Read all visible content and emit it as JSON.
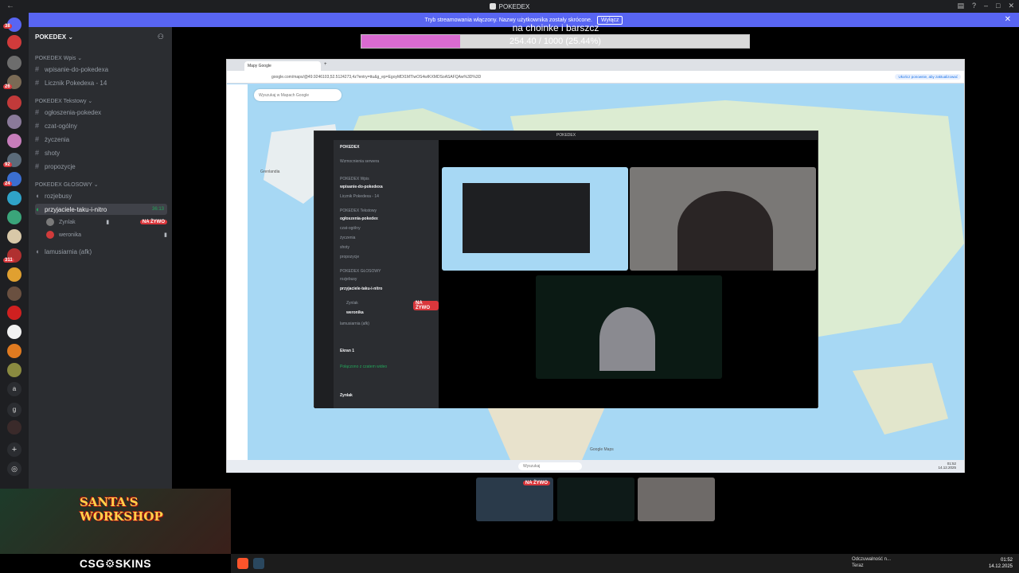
{
  "window": {
    "title": "POKEDEX"
  },
  "banner": {
    "text": "Tryb streamowania włączony. Nazwy użytkownika zostały skrócone.",
    "button": "Wyłącz"
  },
  "rail": {
    "badges": [
      "38",
      "26",
      "92",
      "24",
      "311"
    ]
  },
  "sidebar": {
    "server_name": "POKEDEX",
    "categories": [
      {
        "label": "POKEDEX Wpis",
        "channels": [
          "wpisanie-do-pokedexa",
          "Licznik Pokedexa - 14"
        ]
      },
      {
        "label": "POKEDEX Tekstowy",
        "channels": [
          "ogłoszenia-pokedex",
          "czat-ogólny",
          "życzenia",
          "shoty",
          "propozycje"
        ]
      },
      {
        "label": "POKEDEX GŁOSOWY",
        "channels": [
          "rozjebusy",
          "przyjaciele-taku-i-nitro",
          "lamusiarnia (afk)"
        ]
      }
    ],
    "active_timer": "36:13",
    "members": [
      {
        "name": "Zynlak",
        "badge": "NA ŻYWO"
      },
      {
        "name": "weronika"
      }
    ]
  },
  "stream": {
    "progress_title": "na choinke i barszcz",
    "progress_text": "254.40 / 1000 (25.44%)",
    "progress_fraction": 0.2544
  },
  "browser": {
    "tab": "Mapy Google",
    "url": "google.com/maps/@49.9246103,52.5124273,4z?entry=ttu&g_ep=EgoyMDI1MTIwOS4wIKXMDSoASAFQAw%3D%3D",
    "pill": "Ukończ ponownie, aby zaktualizować",
    "search_placeholder": "Wyszukaj w Mapach Google",
    "map_labels": [
      "Grenlandia",
      "Google Maps"
    ],
    "taskbar_search": "Wyszukaj",
    "taskbar_time": "01:52",
    "taskbar_date": "14.12.2025"
  },
  "nested": {
    "title": "POKEDEX",
    "server_name": "POKEDEX",
    "lines": [
      "Wzmocnienia serwera",
      "POKEDEX Wpis",
      "wpisanie-do-pokedexa",
      "Licznik Pokedexa - 14",
      "POKEDEX Tekstowy",
      "ogłoszenia-pokedex",
      "czat-ogólny",
      "życzenia",
      "shoty",
      "propozycje",
      "POKEDEX GŁOSOWY",
      "rozjebusy",
      "przyjaciele-taku-i-nitro",
      "Zynlak",
      "weronika",
      "lamusiarnia (afk)",
      "Ekran 1",
      "Połączono z czatem wideo",
      "Zynlak"
    ],
    "live_badge": "NA ŻYWO"
  },
  "thumbs": {
    "live_badge": "NA ŻYWO"
  },
  "ad": {
    "title_line1": "SANTA'S",
    "title_line2": "WORKSHOP",
    "brand": "CSG⚙SKINS"
  },
  "wintaskbar": {
    "notif_line1": "Odczuwalność n...",
    "notif_line2": "Teraz",
    "time": "01:52",
    "date": "14.12.2025"
  },
  "colors": {
    "accent": "#5865f2",
    "live": "#da373c",
    "progress_fill": "#d96bd1",
    "online": "#23a55a"
  }
}
